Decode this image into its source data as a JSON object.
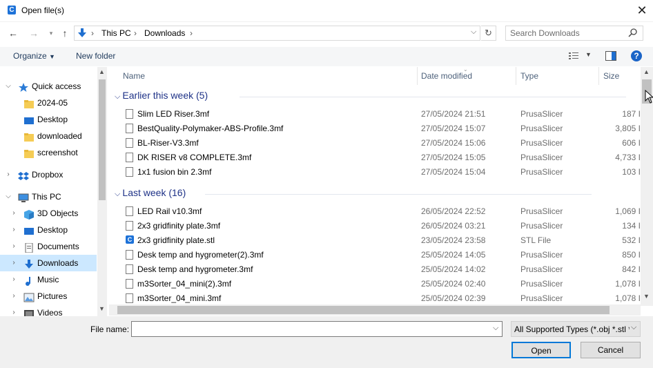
{
  "window": {
    "title": "Open file(s)",
    "app_icon_glyph": "C"
  },
  "address": {
    "segments": [
      "This PC",
      "Downloads"
    ]
  },
  "search": {
    "placeholder": "Search Downloads"
  },
  "toolbar": {
    "organize": "Organize",
    "new_folder": "New folder"
  },
  "nav": [
    {
      "label": "Quick access",
      "icon": "star-icon",
      "chevron": "v",
      "indent": 0
    },
    {
      "label": "2024-05",
      "icon": "folder-icon",
      "chevron": "",
      "indent": 1
    },
    {
      "label": "Desktop",
      "icon": "desktop-icon",
      "chevron": "",
      "indent": 1
    },
    {
      "label": "downloaded",
      "icon": "folder-icon",
      "chevron": "",
      "indent": 1
    },
    {
      "label": "screenshot",
      "icon": "folder-icon",
      "chevron": "",
      "indent": 1
    },
    {
      "label": "Dropbox",
      "icon": "dropbox-icon",
      "chevron": ">",
      "indent": 0
    },
    {
      "label": "This PC",
      "icon": "pc-icon",
      "chevron": "v",
      "indent": 0
    },
    {
      "label": "3D Objects",
      "icon": "cube-icon",
      "chevron": ">",
      "indent": 1
    },
    {
      "label": "Desktop",
      "icon": "desktop-icon",
      "chevron": ">",
      "indent": 1
    },
    {
      "label": "Documents",
      "icon": "documents-icon",
      "chevron": ">",
      "indent": 1
    },
    {
      "label": "Downloads",
      "icon": "download-icon",
      "chevron": ">",
      "indent": 1,
      "selected": true
    },
    {
      "label": "Music",
      "icon": "music-icon",
      "chevron": ">",
      "indent": 1
    },
    {
      "label": "Pictures",
      "icon": "pictures-icon",
      "chevron": ">",
      "indent": 1
    },
    {
      "label": "Videos",
      "icon": "videos-icon",
      "chevron": ">",
      "indent": 1
    }
  ],
  "columns": {
    "name": "Name",
    "date": "Date modified",
    "type": "Type",
    "size": "Size"
  },
  "groups": [
    {
      "label": "Earlier this week (5)",
      "files": [
        {
          "name": "Slim LED Riser.3mf",
          "date": "27/05/2024 21:51",
          "type": "PrusaSlicer",
          "size": "187 I",
          "icon": "file-icon"
        },
        {
          "name": "BestQuality-Polymaker-ABS-Profile.3mf",
          "date": "27/05/2024 15:07",
          "type": "PrusaSlicer",
          "size": "3,805 I",
          "icon": "file-icon"
        },
        {
          "name": "BL-Riser-V3.3mf",
          "date": "27/05/2024 15:06",
          "type": "PrusaSlicer",
          "size": "606 I",
          "icon": "file-icon"
        },
        {
          "name": "DK RISER v8 COMPLETE.3mf",
          "date": "27/05/2024 15:05",
          "type": "PrusaSlicer",
          "size": "4,733 I",
          "icon": "file-icon"
        },
        {
          "name": "1x1 fusion bin 2.3mf",
          "date": "27/05/2024 15:04",
          "type": "PrusaSlicer",
          "size": "103 I",
          "icon": "file-icon"
        }
      ]
    },
    {
      "label": "Last week (16)",
      "files": [
        {
          "name": "LED Rail v10.3mf",
          "date": "26/05/2024 22:52",
          "type": "PrusaSlicer",
          "size": "1,069 I",
          "icon": "file-icon"
        },
        {
          "name": "2x3 gridfinity plate.3mf",
          "date": "26/05/2024 03:21",
          "type": "PrusaSlicer",
          "size": "134 I",
          "icon": "file-icon"
        },
        {
          "name": "2x3 gridfinity plate.stl",
          "date": "23/05/2024 23:58",
          "type": "STL File",
          "size": "532 I",
          "icon": "stl-icon"
        },
        {
          "name": "Desk temp and hygrometer(2).3mf",
          "date": "25/05/2024 14:05",
          "type": "PrusaSlicer",
          "size": "850 I",
          "icon": "file-icon"
        },
        {
          "name": "Desk temp and hygrometer.3mf",
          "date": "25/05/2024 14:02",
          "type": "PrusaSlicer",
          "size": "842 I",
          "icon": "file-icon"
        },
        {
          "name": "m3Sorter_04_mini(2).3mf",
          "date": "25/05/2024 02:40",
          "type": "PrusaSlicer",
          "size": "1,078 I",
          "icon": "file-icon"
        },
        {
          "name": "m3Sorter_04_mini.3mf",
          "date": "25/05/2024 02:39",
          "type": "PrusaSlicer",
          "size": "1,078 I",
          "icon": "file-icon"
        }
      ]
    }
  ],
  "footer": {
    "filename_label": "File name:",
    "filename_value": "",
    "filetype": "All Supported Types (*.obj *.stl *",
    "open": "Open",
    "cancel": "Cancel"
  }
}
